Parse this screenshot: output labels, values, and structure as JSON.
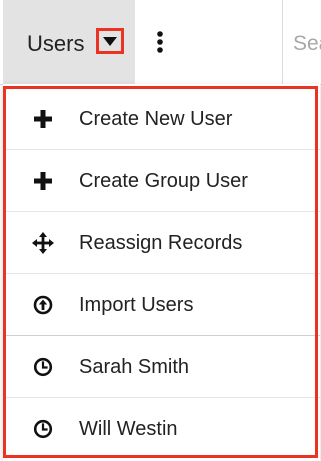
{
  "module_tab": {
    "label": "Users",
    "caret_icon": "caret-down-icon",
    "actions_icon": "kebab-vertical-icon"
  },
  "search": {
    "placeholder_visible": "Sea"
  },
  "menu": {
    "actions": [
      {
        "icon": "plus-icon",
        "label": "Create New User"
      },
      {
        "icon": "plus-icon",
        "label": "Create Group User"
      },
      {
        "icon": "move-arrows-icon",
        "label": "Reassign Records"
      },
      {
        "icon": "upload-circle-icon",
        "label": "Import Users"
      }
    ],
    "recent": [
      {
        "icon": "clock-icon",
        "label": "Sarah Smith"
      },
      {
        "icon": "clock-icon",
        "label": "Will Westin"
      }
    ]
  },
  "colors": {
    "highlight": "#ea3323",
    "tab_background": "#e3e3e3",
    "text": "#222222"
  }
}
